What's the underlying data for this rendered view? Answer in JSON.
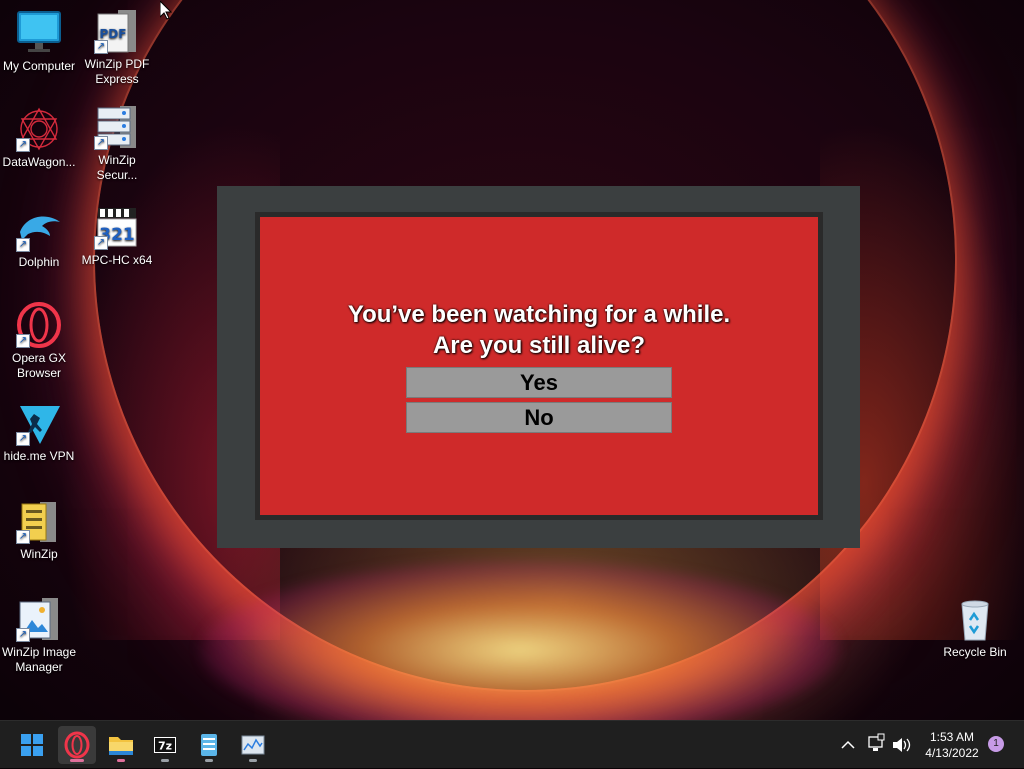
{
  "desktop": {
    "icons": [
      {
        "id": "my-computer",
        "label": "My Computer"
      },
      {
        "id": "winzip-pdf",
        "label": "WinZip PDF Express"
      },
      {
        "id": "datawagon",
        "label": "DataWagon..."
      },
      {
        "id": "winzip-secure",
        "label": "WinZip Secur..."
      },
      {
        "id": "dolphin",
        "label": "Dolphin"
      },
      {
        "id": "mpc-hc",
        "label": "MPC-HC x64"
      },
      {
        "id": "opera-gx",
        "label": "Opera GX Browser"
      },
      {
        "id": "hideme",
        "label": "hide.me VPN"
      },
      {
        "id": "winzip",
        "label": "WinZip"
      },
      {
        "id": "winzip-image",
        "label": "WinZip Image Manager"
      },
      {
        "id": "recycle-bin",
        "label": "Recycle Bin"
      }
    ]
  },
  "dialog": {
    "line1": "You’ve been watching for a while.",
    "line2": "Are you still alive?",
    "yes_label": "Yes",
    "no_label": "No"
  },
  "taskbar": {
    "apps": [
      "start-icon",
      "opera-gx-icon",
      "file-explorer-icon",
      "7zip-icon",
      "notepad-icon",
      "performance-monitor-icon"
    ],
    "clock": {
      "time": "1:53 AM",
      "date": "4/13/2022"
    },
    "notification_count": "1"
  }
}
